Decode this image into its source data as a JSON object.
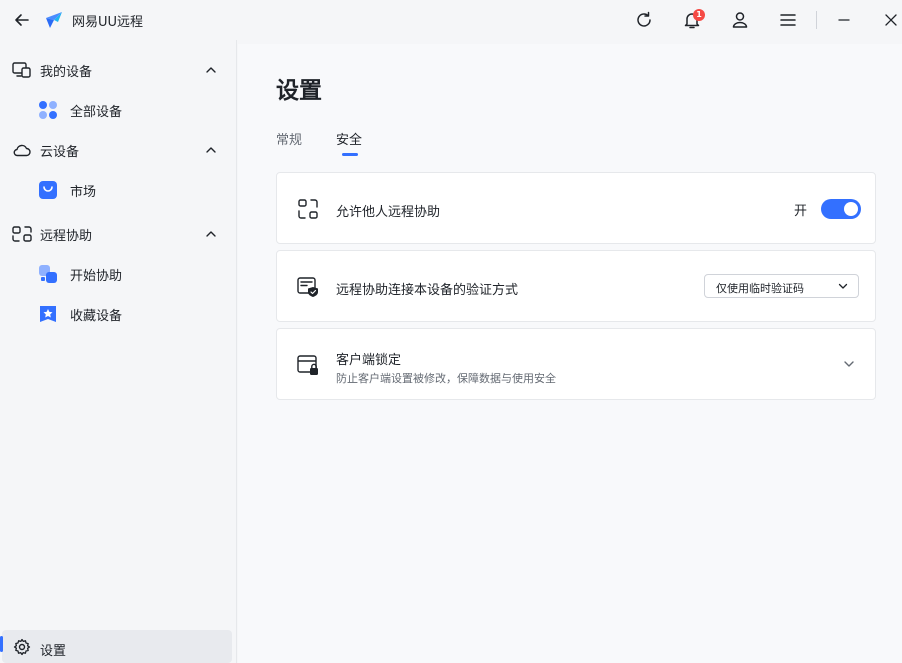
{
  "app": {
    "title": "网易UU远程"
  },
  "titlebar": {
    "notification_count": "1"
  },
  "sidebar": {
    "groups": [
      {
        "label": "我的设备",
        "items": [
          {
            "label": "全部设备"
          }
        ]
      },
      {
        "label": "云设备",
        "items": [
          {
            "label": "市场"
          }
        ]
      },
      {
        "label": "远程协助",
        "items": [
          {
            "label": "开始协助"
          },
          {
            "label": "收藏设备"
          }
        ]
      }
    ],
    "settings_label": "设置"
  },
  "main": {
    "title": "设置",
    "tabs": [
      {
        "label": "常规"
      },
      {
        "label": "安全",
        "active": true
      }
    ],
    "cards": [
      {
        "title": "允许他人远程协助",
        "toggle_label": "开",
        "toggle_on": true
      },
      {
        "title": "远程协助连接本设备的验证方式",
        "select_value": "仅使用临时验证码"
      },
      {
        "title": "客户端锁定",
        "description": "防止客户端设置被修改，保障数据与使用安全"
      }
    ]
  },
  "colors": {
    "accent": "#3370ff",
    "badge": "#f54a45"
  }
}
